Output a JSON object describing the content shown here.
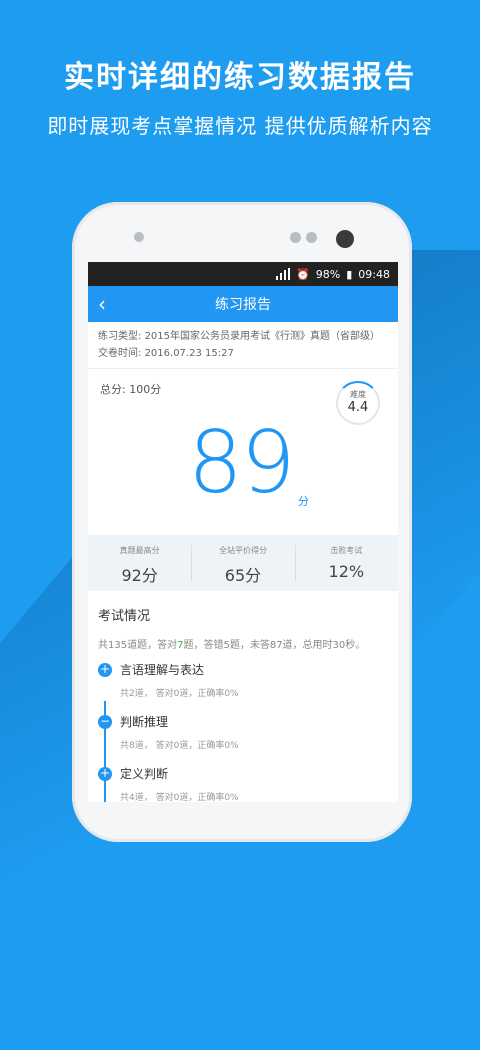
{
  "promo": {
    "headline": "实时详细的练习数据报告",
    "subline": "即时展现考点掌握情况 提供优质解析内容"
  },
  "status": {
    "battery": "98%",
    "time": "09:48"
  },
  "appbar": {
    "back": "‹",
    "title": "练习报告"
  },
  "meta": {
    "type_label": "练习类型:",
    "type_value": "2015年国家公务员录用考试《行测》真题（省部级）",
    "time_label": "交卷时间:",
    "time_value": "2016.07.23  15:27"
  },
  "score": {
    "total": "总分: 100分",
    "value": "89",
    "unit": "分",
    "difficulty_label": "难度",
    "difficulty_value": "4.4"
  },
  "stats": [
    {
      "label": "真题最高分",
      "value": "92分"
    },
    {
      "label": "全站平价得分",
      "value": "65分"
    },
    {
      "label": "击败考试",
      "value": "12%"
    }
  ],
  "exam": {
    "title": "考试情况",
    "summary_a": "共135道题，答对",
    "summary_hl": "7",
    "summary_b": "题，答错5题，未答87道，总用时30秒。",
    "items": [
      {
        "icon": "+",
        "name": "言语理解与表达",
        "detail": "共2道，  答对0道，正确率0%"
      },
      {
        "icon": "−",
        "name": "判断推理",
        "detail": "共8道，  答对0道，正确率0%"
      },
      {
        "icon": "+",
        "name": "定义判断",
        "detail": "共4道，  答对0道，正确率0%"
      }
    ]
  },
  "colors": {
    "brand": "#2196f3",
    "background": "#1e9cf0"
  }
}
